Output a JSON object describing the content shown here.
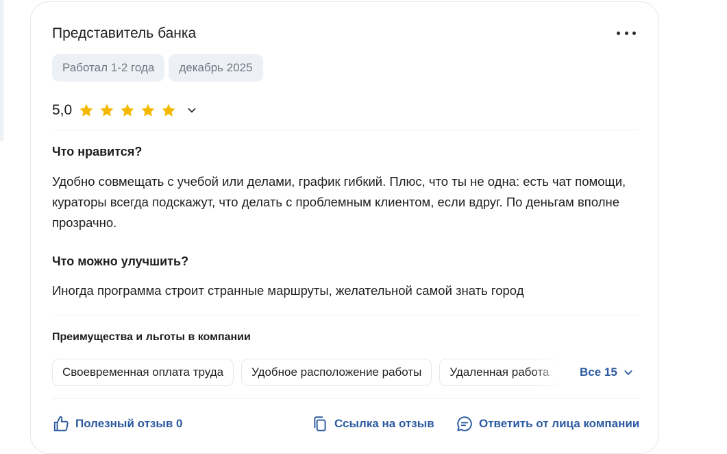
{
  "review": {
    "title": "Представитель банка",
    "tags": [
      "Работал 1-2 года",
      "декабрь 2025"
    ],
    "rating": {
      "value": "5,0",
      "stars": 5,
      "max_stars": 5,
      "star_color": "#f5b800"
    },
    "likes": {
      "heading": "Что нравится?",
      "text": "Удобно совмещать с учебой или делами, график гибкий. Плюс, что ты не одна: есть чат помощи, кураторы всегда подскажут, что делать с проблемным клиентом, если вдруг. По деньгам вполне прозрачно."
    },
    "improve": {
      "heading": "Что можно улучшить?",
      "text": "Иногда программа строит странные маршруты, желательной самой знать город"
    },
    "perks": {
      "heading": "Преимущества и льготы в компании",
      "items": [
        "Своевременная оплата труда",
        "Удобное расположение работы",
        "Удаленная работа"
      ],
      "all_label": "Все 15"
    },
    "actions": {
      "helpful": "Полезный отзыв 0",
      "link": "Ссылка на отзыв",
      "reply": "Ответить от лица компании"
    }
  },
  "colors": {
    "accent": "#2c5aa0",
    "tag_bg": "#edf0f5",
    "tag_text": "#6f7782",
    "border": "#e3e6eb"
  },
  "icons": [
    "more-icon",
    "star-icon",
    "chevron-down-icon",
    "thumbs-up-icon",
    "copy-link-icon",
    "reply-icon"
  ]
}
